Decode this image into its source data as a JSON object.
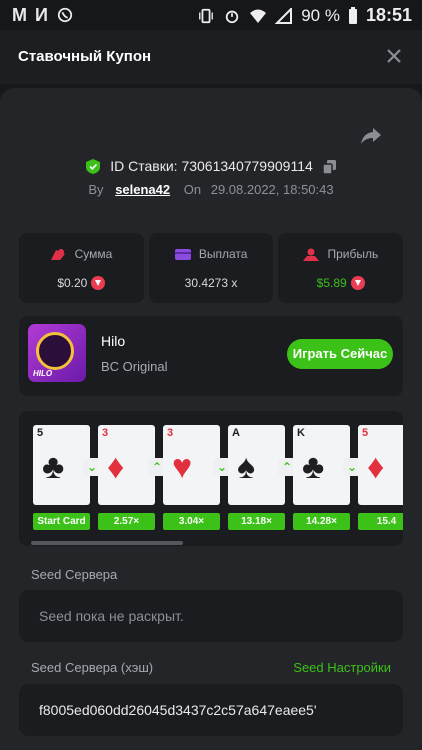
{
  "status_bar": {
    "apps": [
      "M",
      "И"
    ],
    "battery": "90 %",
    "time": "18:51"
  },
  "header": {
    "title": "Ставочный Купон"
  },
  "bet": {
    "id_label": "ID Ставки: 73061340779909114",
    "by_label": "By",
    "user": "selena42",
    "on_label": "On",
    "date": "29.08.2022, 18:50:43"
  },
  "stats": [
    {
      "label": "Сумма",
      "value": "$0.20",
      "icon": "coins-icon",
      "coin": true
    },
    {
      "label": "Выплата",
      "value": "30.4273 x",
      "icon": "wallet-icon",
      "coin": false
    },
    {
      "label": "Прибыль",
      "value": "$5.89",
      "icon": "profit-icon",
      "coin": true
    }
  ],
  "game": {
    "name": "Hilo",
    "provider": "BC Original",
    "play_label": "Играть Сейчас",
    "thumb_logo": "HILO"
  },
  "cards": [
    {
      "rank": "5",
      "suit": "♣",
      "color": "black",
      "mult": "Start Card",
      "arrow": "down"
    },
    {
      "rank": "3",
      "suit": "♦",
      "color": "red",
      "mult": "2.57×",
      "arrow": "up"
    },
    {
      "rank": "3",
      "suit": "♥",
      "color": "red",
      "mult": "3.04×",
      "arrow": "down"
    },
    {
      "rank": "A",
      "suit": "♠",
      "color": "black",
      "mult": "13.18×",
      "arrow": "up"
    },
    {
      "rank": "K",
      "suit": "♣",
      "color": "black",
      "mult": "14.28×",
      "arrow": "down"
    },
    {
      "rank": "5",
      "suit": "♦",
      "color": "red",
      "mult": "15.4",
      "arrow": ""
    }
  ],
  "seed": {
    "server_label": "Seed Сервера",
    "server_value": "Seed пока не раскрыт.",
    "hash_label": "Seed Сервера (хэш)",
    "settings_label": "Seed Настройки",
    "hash_value": "f8005ed060dd26045d3437c2c57a647eaee5'"
  },
  "colors": {
    "accent": "#3bc117",
    "background": "#17181b",
    "panel": "#232529",
    "card": "#1b1c20"
  }
}
